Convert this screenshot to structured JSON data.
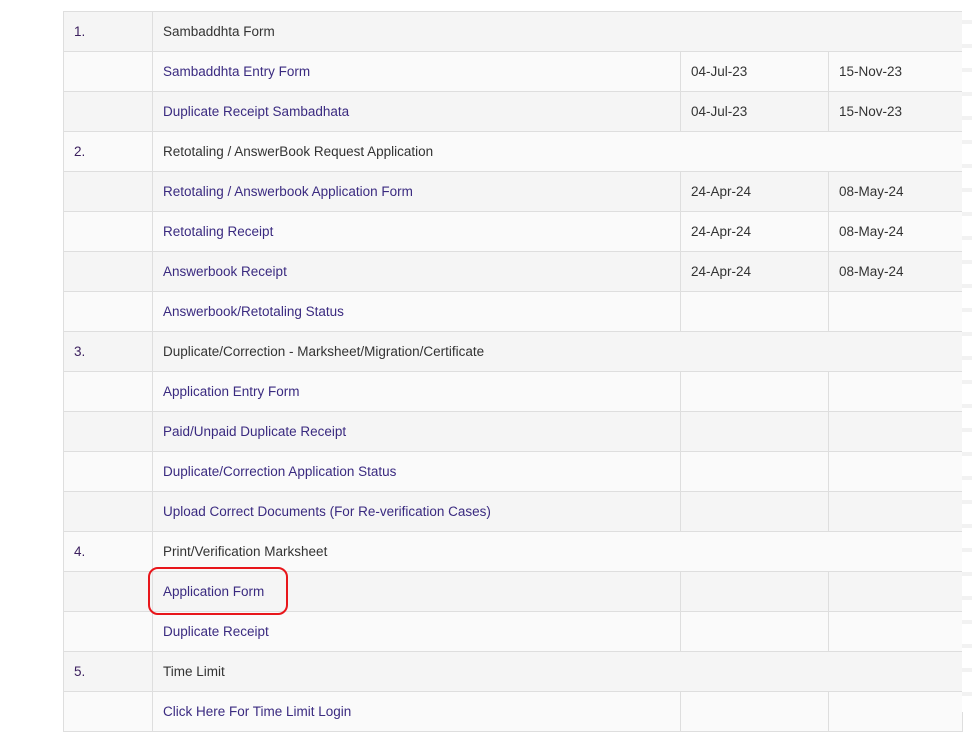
{
  "sections": [
    {
      "num": "1.",
      "title": "Sambaddhta Form",
      "items": [
        {
          "label": "Sambaddhta Entry Form",
          "start": "04-Jul-23",
          "end": "15-Nov-23"
        },
        {
          "label": "Duplicate Receipt Sambadhata",
          "start": "04-Jul-23",
          "end": "15-Nov-23"
        }
      ]
    },
    {
      "num": "2.",
      "title": "Retotaling / AnswerBook Request Application",
      "items": [
        {
          "label": "Retotaling / Answerbook Application Form",
          "start": "24-Apr-24",
          "end": "08-May-24"
        },
        {
          "label": "Retotaling Receipt",
          "start": "24-Apr-24",
          "end": "08-May-24"
        },
        {
          "label": "Answerbook Receipt",
          "start": "24-Apr-24",
          "end": "08-May-24"
        },
        {
          "label": "Answerbook/Retotaling Status",
          "start": "",
          "end": ""
        }
      ]
    },
    {
      "num": "3.",
      "title": "Duplicate/Correction - Marksheet/Migration/Certificate",
      "items": [
        {
          "label": "Application Entry Form",
          "start": "",
          "end": ""
        },
        {
          "label": "Paid/Unpaid Duplicate Receipt",
          "start": "",
          "end": ""
        },
        {
          "label": "Duplicate/Correction Application Status",
          "start": "",
          "end": ""
        },
        {
          "label": "Upload Correct Documents (For Re-verification Cases)",
          "start": "",
          "end": ""
        }
      ]
    },
    {
      "num": "4.",
      "title": "Print/Verification Marksheet",
      "items": [
        {
          "label": "Application Form",
          "start": "",
          "end": ""
        },
        {
          "label": "Duplicate Receipt",
          "start": "",
          "end": ""
        }
      ]
    },
    {
      "num": "5.",
      "title": "Time Limit",
      "items": [
        {
          "label": "Click Here For Time Limit Login",
          "start": "",
          "end": ""
        }
      ]
    }
  ],
  "colors": {
    "link": "#3a2a80",
    "highlight": "#e8161b"
  }
}
